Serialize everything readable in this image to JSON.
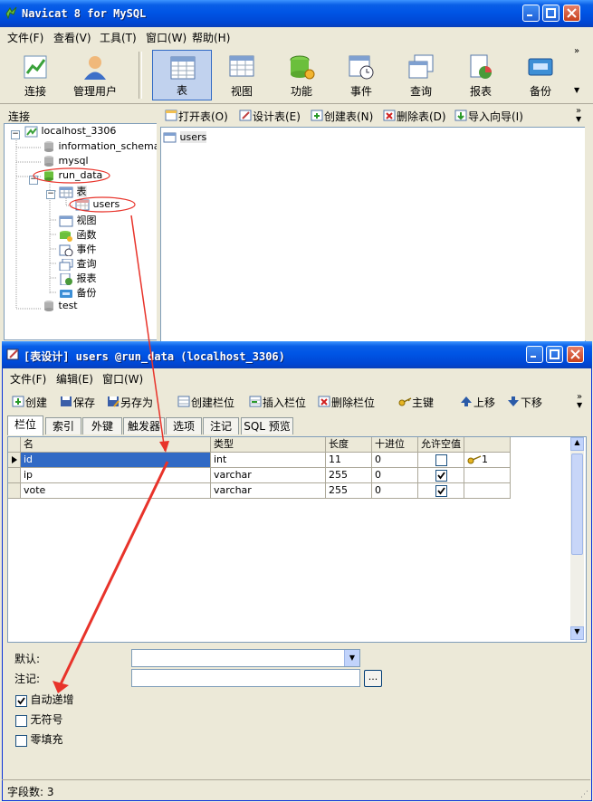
{
  "main_window": {
    "title": "Navicat 8 for MySQL",
    "menu": [
      "文件(F)",
      "查看(V)",
      "工具(T)",
      "窗口(W)",
      "帮助(H)"
    ],
    "toolbar": [
      "连接",
      "管理用户",
      "表",
      "视图",
      "功能",
      "事件",
      "查询",
      "报表",
      "备份"
    ],
    "connection_panel_label": "连接",
    "tree": {
      "connection": "localhost_3306",
      "databases": [
        "information_schema",
        "mysql",
        "run_data",
        "test"
      ],
      "run_data_children": [
        "表",
        "视图",
        "函数",
        "事件",
        "查询",
        "报表",
        "备份"
      ],
      "tables": [
        "users"
      ]
    },
    "object_toolbar": [
      "打开表(O)",
      "设计表(E)",
      "创建表(N)",
      "删除表(D)",
      "导入向导(I)"
    ],
    "object_list": [
      "users"
    ]
  },
  "design_window": {
    "title": "[表设计] users @run_data (localhost_3306)",
    "menu": [
      "文件(F)",
      "编辑(E)",
      "窗口(W)"
    ],
    "toolbar": [
      "创建",
      "保存",
      "另存为",
      "创建栏位",
      "插入栏位",
      "删除栏位",
      "主键",
      "上移",
      "下移"
    ],
    "tabs": [
      "栏位",
      "索引",
      "外键",
      "触发器",
      "选项",
      "注记",
      "SQL 预览"
    ],
    "columns": [
      "名",
      "类型",
      "长度",
      "十进位",
      "允许空值"
    ],
    "rows": [
      {
        "name": "id",
        "type": "int",
        "length": "11",
        "decimals": "0",
        "nullable": false,
        "key": "1"
      },
      {
        "name": "ip",
        "type": "varchar",
        "length": "255",
        "decimals": "0",
        "nullable": true,
        "key": ""
      },
      {
        "name": "vote",
        "type": "varchar",
        "length": "255",
        "decimals": "0",
        "nullable": true,
        "key": ""
      }
    ],
    "props": {
      "default_label": "默认:",
      "comment_label": "注记:",
      "comment_button": "...",
      "auto_increment": "自动递增",
      "unsigned": "无符号",
      "zerofill": "零填充",
      "auto_increment_checked": true,
      "unsigned_checked": false,
      "zerofill_checked": false
    },
    "status": "字段数: 3"
  },
  "colors": {
    "titlebar": "#0055e5",
    "annotation": "#e8332a",
    "selection": "#316ac5"
  }
}
